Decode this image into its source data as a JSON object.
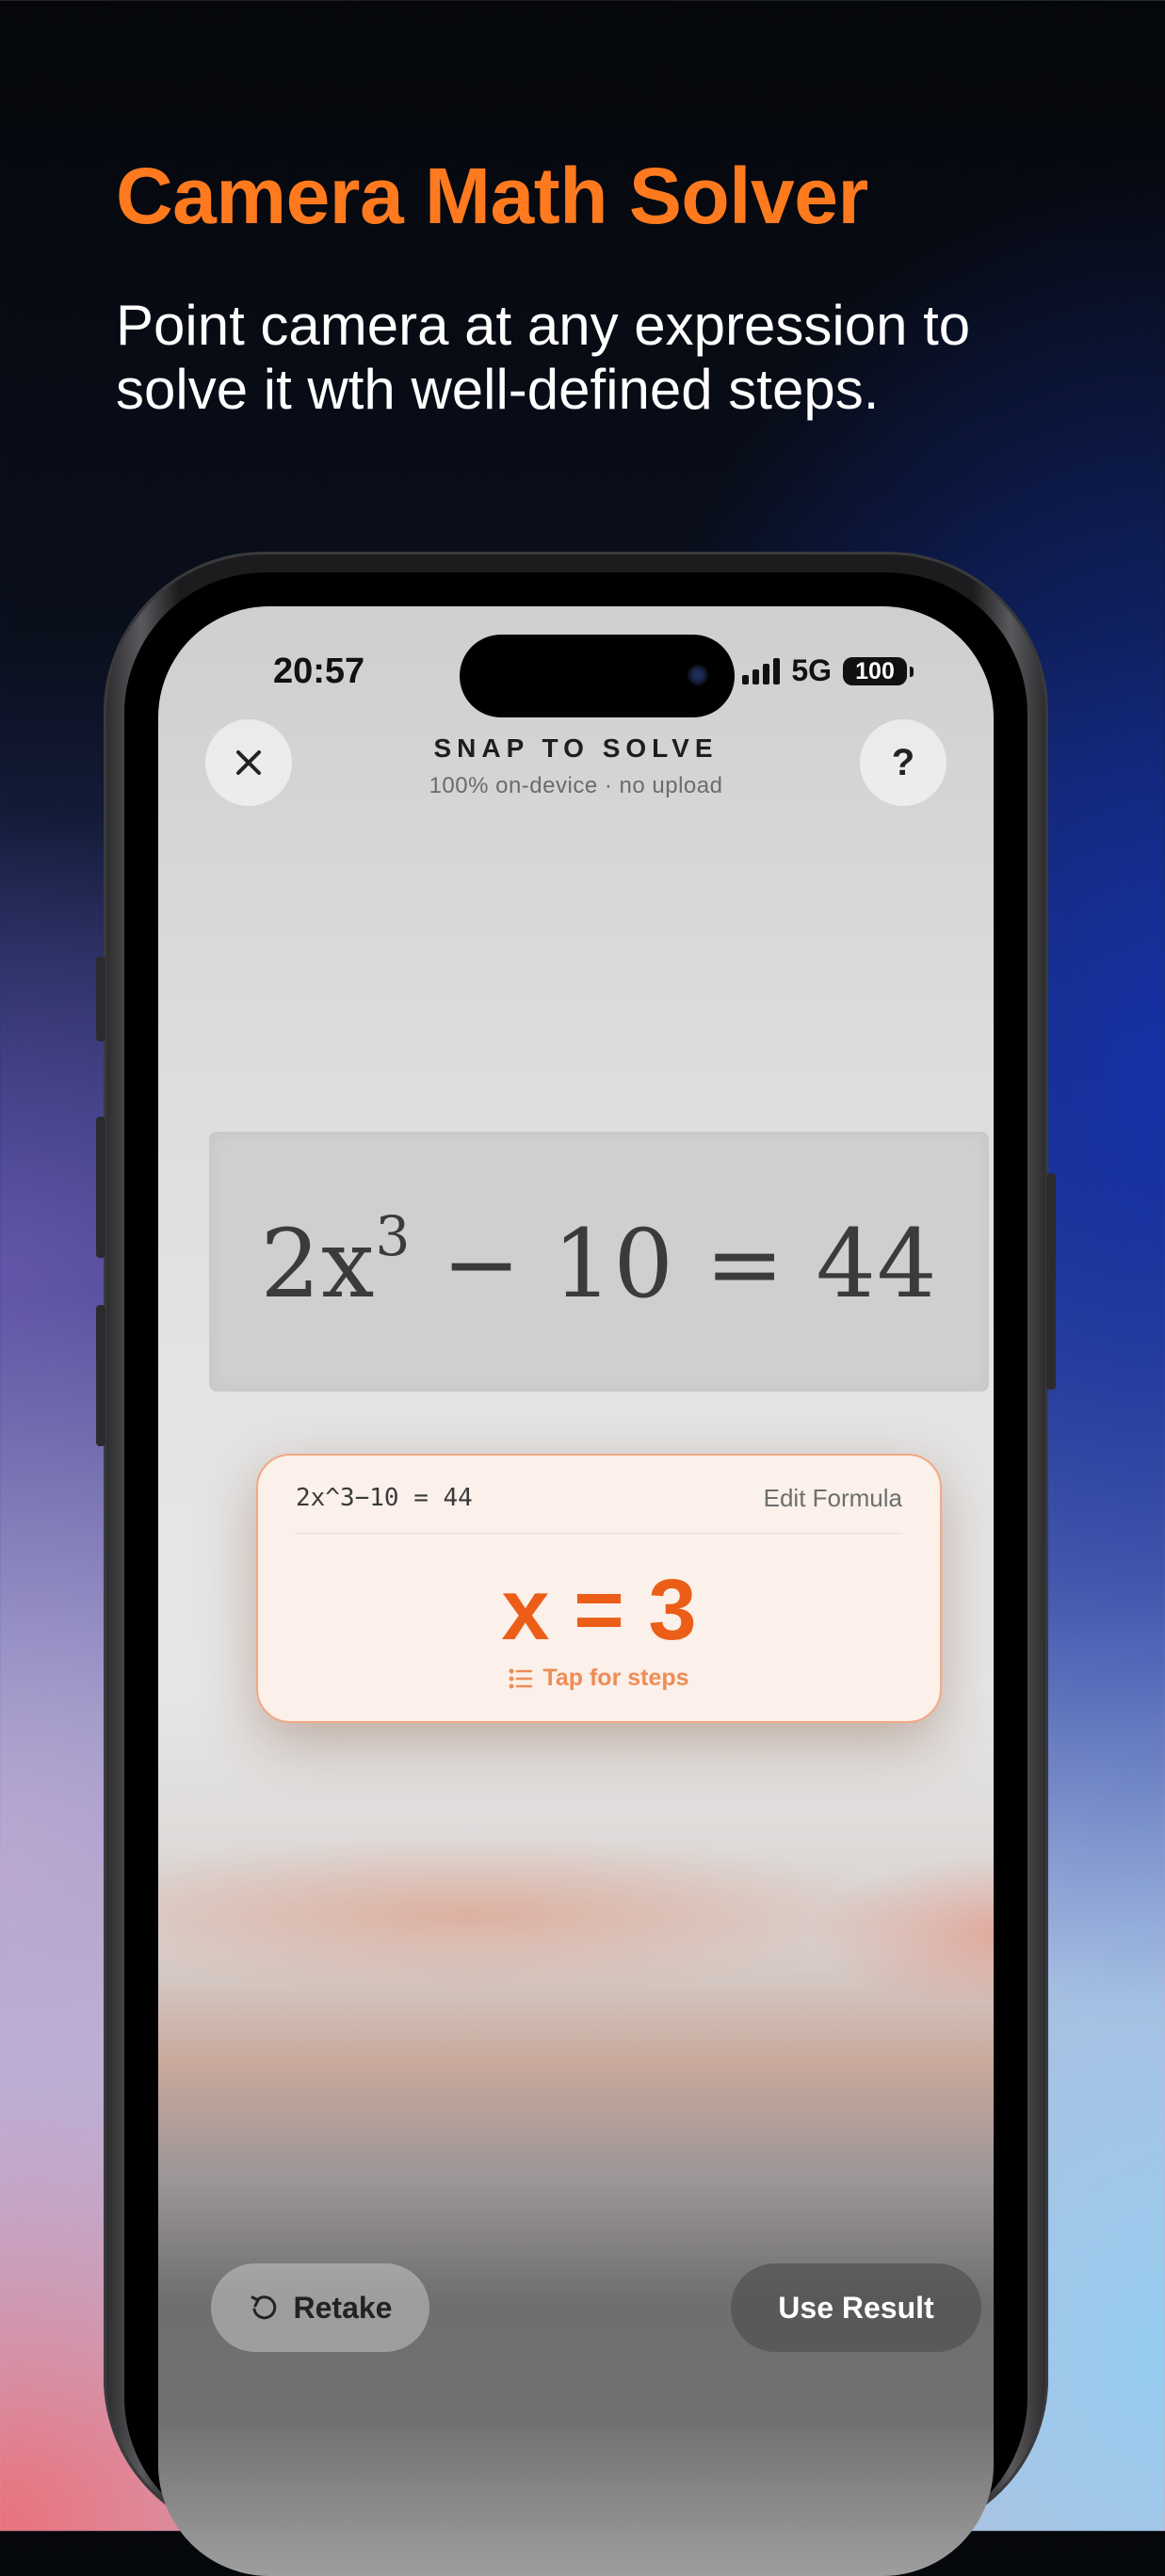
{
  "promo": {
    "headline": "Camera Math Solver",
    "subline": "Point camera at any expression to solve it wth well-defined steps."
  },
  "status_bar": {
    "time": "20:57",
    "network": "5G",
    "battery": "100"
  },
  "header": {
    "close_icon": "close-icon",
    "title": "SNAP TO SOLVE",
    "subtitle": "100% on-device · no upload",
    "help_label": "?"
  },
  "camera": {
    "equation_base": "2x",
    "equation_exp": "3",
    "equation_rest": " − 10 = 44"
  },
  "result_card": {
    "formula": "2x^3−10 = 44",
    "edit_label": "Edit Formula",
    "answer": "x = 3",
    "steps_label": "Tap for steps",
    "steps_icon": "list-icon",
    "accent_color": "#ec5e17"
  },
  "actions": {
    "retake_label": "Retake",
    "retake_icon": "retake-icon",
    "use_label": "Use Result"
  }
}
